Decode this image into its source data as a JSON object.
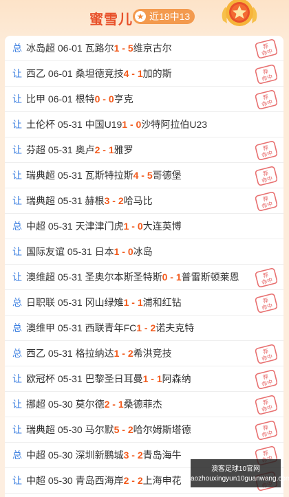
{
  "header": {
    "expert_name": "蜜雪儿",
    "streak": "近18中13",
    "star": "★"
  },
  "rows": [
    {
      "type": "总",
      "pre": "冰岛超 06-01 瓦路尔",
      "home": "1",
      "sep": " - ",
      "away": "5",
      "post": "维京古尔",
      "hit": true
    },
    {
      "type": "让",
      "pre": "西乙 06-01 桑坦德竞技",
      "home": "4",
      "sep": " - ",
      "away": "1",
      "post": "加的斯",
      "hit": true
    },
    {
      "type": "让",
      "pre": "比甲 06-01 根特",
      "home": "0",
      "sep": " - ",
      "away": "0",
      "post": "亨克",
      "hit": true
    },
    {
      "type": "让",
      "pre": "土伦杯 05-31 中国U19",
      "home": "1",
      "sep": " - ",
      "away": "0",
      "post": "沙特阿拉伯U23",
      "hit": false
    },
    {
      "type": "让",
      "pre": "芬超 05-31 奥卢",
      "home": "2",
      "sep": " - ",
      "away": "1",
      "post": "雅罗",
      "hit": true
    },
    {
      "type": "让",
      "pre": "瑞典超 05-31 瓦斯特拉斯",
      "home": "4",
      "sep": " - ",
      "away": "5",
      "post": "哥德堡",
      "hit": true
    },
    {
      "type": "让",
      "pre": "瑞典超 05-31 赫根",
      "home": "3",
      "sep": " - ",
      "away": "2",
      "post": "哈马比",
      "hit": true
    },
    {
      "type": "总",
      "pre": "中超 05-31 天津津门虎",
      "home": "1",
      "sep": " - ",
      "away": "0",
      "post": "大连英博",
      "hit": false
    },
    {
      "type": "让",
      "pre": "国际友谊 05-31 日本",
      "home": "1",
      "sep": " - ",
      "away": "0",
      "post": "冰岛",
      "hit": false
    },
    {
      "type": "让",
      "pre": "澳维超 05-31 圣奥尔本斯圣特斯",
      "home": "0",
      "sep": " - ",
      "away": "1",
      "post": "普雷斯顿莱恩",
      "hit": true
    },
    {
      "type": "总",
      "pre": "日职联 05-31 冈山绿雉",
      "home": "1",
      "sep": " - ",
      "away": "1",
      "post": "浦和红钻",
      "hit": true
    },
    {
      "type": "总",
      "pre": "澳维甲 05-31 西联青年FC",
      "home": "1",
      "sep": " - ",
      "away": "2",
      "post": "诺夫克特",
      "hit": false
    },
    {
      "type": "总",
      "pre": "西乙 05-31 格拉纳达",
      "home": "1",
      "sep": " - ",
      "away": "2",
      "post": "希洪竞技",
      "hit": true
    },
    {
      "type": "让",
      "pre": "欧冠杯 05-31 巴黎圣日耳曼",
      "home": "1",
      "sep": " - ",
      "away": "1",
      "post": "阿森纳",
      "hit": true
    },
    {
      "type": "让",
      "pre": "挪超 05-30 莫尔德",
      "home": "2",
      "sep": " - ",
      "away": "1",
      "post": "桑德菲杰",
      "hit": true
    },
    {
      "type": "让",
      "pre": "瑞典超 05-30 马尔默",
      "home": "5",
      "sep": " - ",
      "away": "2",
      "post": "哈尔姆斯塔德",
      "hit": true
    },
    {
      "type": "总",
      "pre": "中超 05-30 深圳新鹏城",
      "home": "3",
      "sep": " - ",
      "away": "2",
      "post": "青岛海牛",
      "hit": true
    },
    {
      "type": "让",
      "pre": "中超 05-30 青岛西海岸",
      "home": "2",
      "sep": " - ",
      "away": "2",
      "post": "上海申花",
      "hit": true
    }
  ],
  "stamp": {
    "line1": "荐",
    "line2": "命中"
  },
  "watermark": {
    "line1": "澳客足球10官网",
    "line2": "aozhouxingyun10guanwang.com"
  },
  "colors": {
    "accent": "#e8512a",
    "score": "#f25a1c",
    "type_label": "#3a7ee0",
    "stamp": "#e04040"
  }
}
